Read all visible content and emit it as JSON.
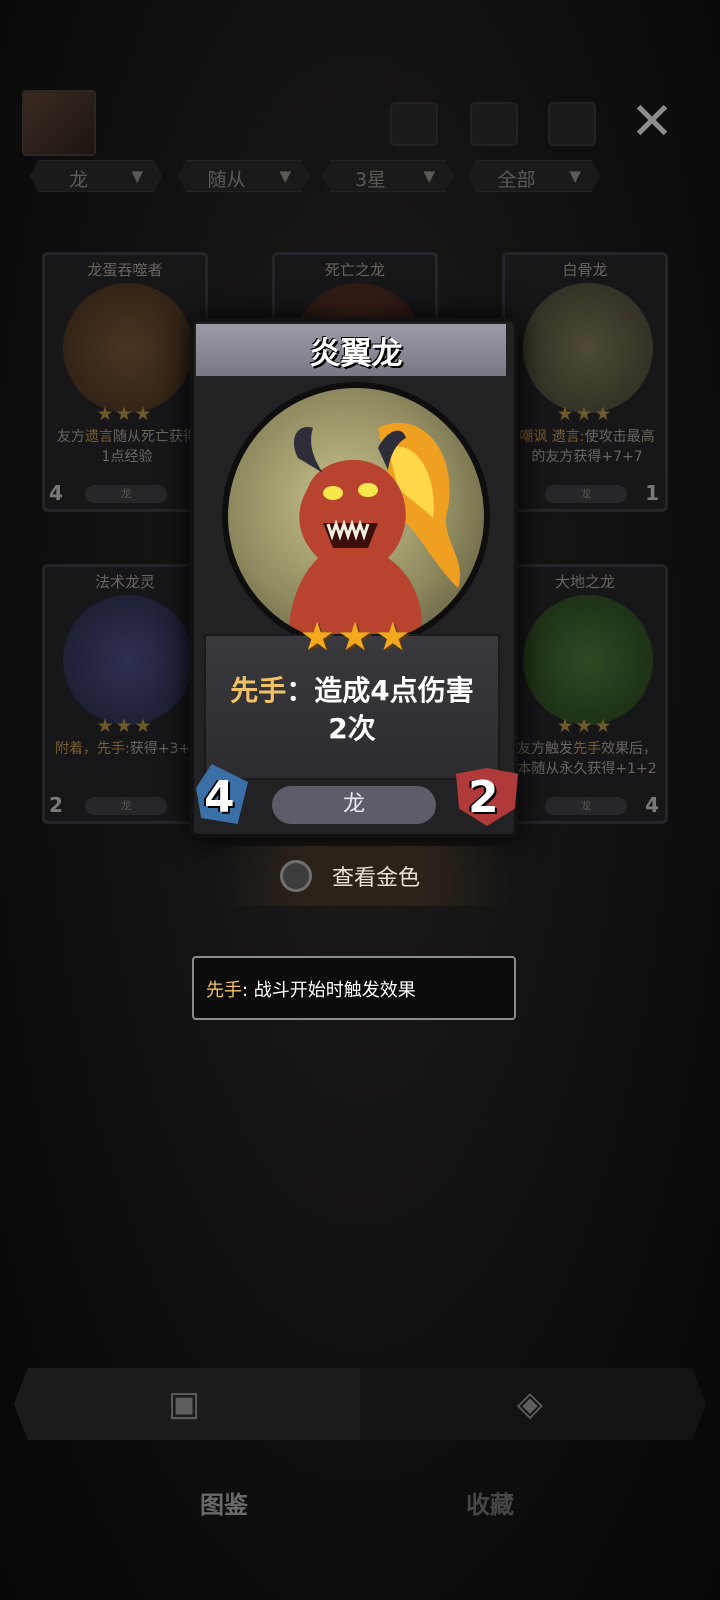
{
  "filters": [
    {
      "label": "龙"
    },
    {
      "label": "随从"
    },
    {
      "label": "3星"
    },
    {
      "label": "全部"
    }
  ],
  "background_cards": [
    {
      "title": "龙蛋吞噬者",
      "stars": "★★★",
      "desc_pre": "友方",
      "desc_kw": "遗言",
      "desc_post": "随从死亡获得1点经验",
      "tribe": "龙",
      "attack": "4",
      "health": ""
    },
    {
      "title": "死亡之龙",
      "stars": "",
      "desc_pre": "",
      "desc_kw": "",
      "desc_post": "",
      "tribe": "",
      "attack": "",
      "health": ""
    },
    {
      "title": "白骨龙",
      "stars": "★★★",
      "desc_pre": "",
      "desc_kw": "嘲讽 遗言:",
      "desc_post": "使攻击最高的友方获得+7+7",
      "tribe": "龙",
      "attack": "",
      "health": "1"
    },
    {
      "title": "法术龙灵",
      "stars": "★★★",
      "desc_pre": "",
      "desc_kw": "附着，先手:",
      "desc_post": "获得+3+3",
      "tribe": "龙",
      "attack": "2",
      "health": ""
    },
    {
      "title": "大地之龙",
      "stars": "★★★",
      "desc_pre": "友方触发",
      "desc_kw": "先手",
      "desc_post": "效果后，本随从永久获得+1+2",
      "tribe": "龙",
      "attack": "",
      "health": "4"
    }
  ],
  "main_card": {
    "title": "炎翼龙",
    "stars": "★★★",
    "keyword": "先手",
    "desc_line1": "：造成4点伤害",
    "desc_line2": "2次",
    "tribe": "龙",
    "attack": "4",
    "health": "2",
    "star_color": "#f3a81e",
    "keyword_color": "#f0c267"
  },
  "gold_toggle": {
    "label": "查看金色",
    "checked": false
  },
  "tooltip": {
    "keyword": "先手",
    "text": ": 战斗开始时触发效果"
  },
  "nav": {
    "tabs": [
      {
        "label": "图鉴",
        "icon": "cards-icon",
        "active": true
      },
      {
        "label": "收藏",
        "icon": "collection-icon",
        "active": false
      }
    ]
  }
}
